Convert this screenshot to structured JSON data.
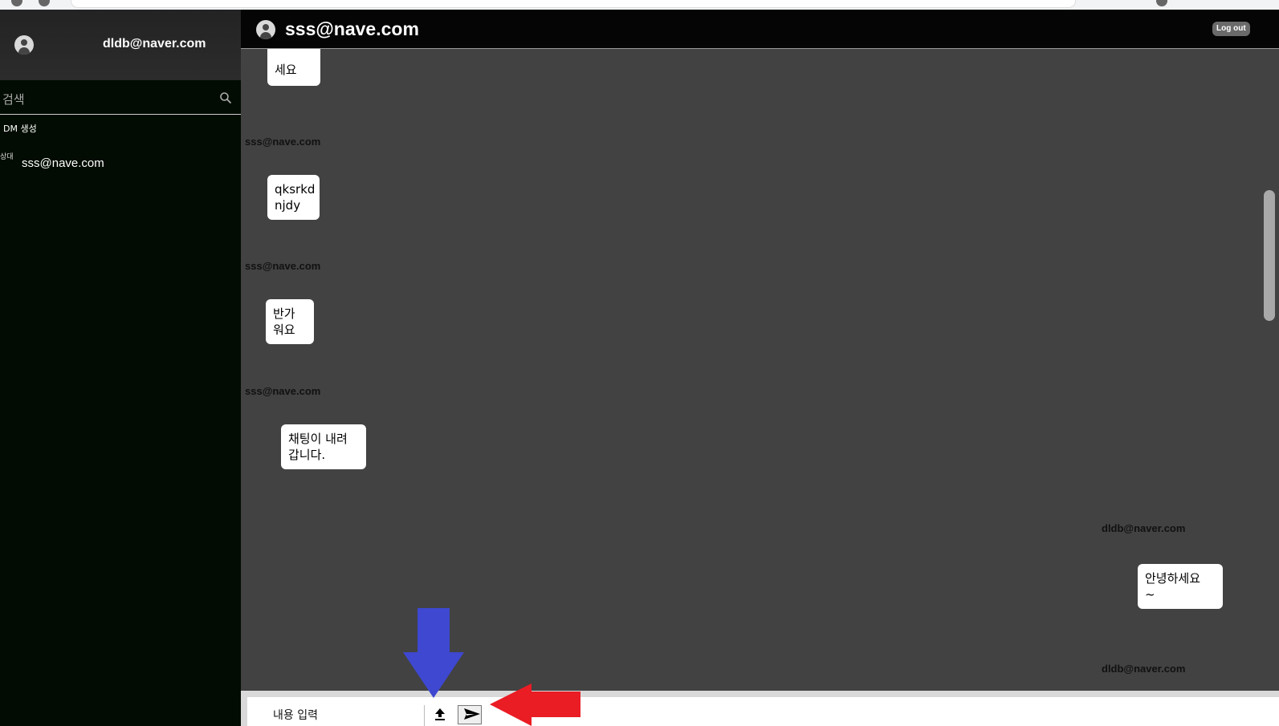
{
  "sidebar": {
    "user_email": "dldb@naver.com",
    "search_placeholder": "검색",
    "dm_create_label": "DM 생성",
    "dm_items": [
      {
        "label": "sss@nave.com",
        "broken_image_alt": "상대"
      }
    ]
  },
  "chat": {
    "title": "sss@nave.com",
    "logout_label": "Log out",
    "messages": [
      {
        "sender": "",
        "text": "세요"
      },
      {
        "sender": "sss@nave.com",
        "text": "qksrkd\nnjdy"
      },
      {
        "sender": "sss@nave.com",
        "text": "반가\n워요"
      },
      {
        "sender": "sss@nave.com",
        "text": "채팅이 내려\n갑니다."
      },
      {
        "sender": "dldb@naver.com",
        "text": "안녕하세요\n~"
      },
      {
        "sender": "dldb@naver.com",
        "text": ""
      }
    ]
  },
  "composer": {
    "input_value": "내용 입력",
    "upload_icon": "upload-icon",
    "send_icon": "send-icon"
  },
  "annotations": {
    "blue_arrow_color": "#3e48d0",
    "red_arrow_color": "#ea1c24"
  },
  "colors": {
    "sidebar_bg": "#020c02",
    "chat_bg": "#424242",
    "header_bg": "#050505"
  }
}
